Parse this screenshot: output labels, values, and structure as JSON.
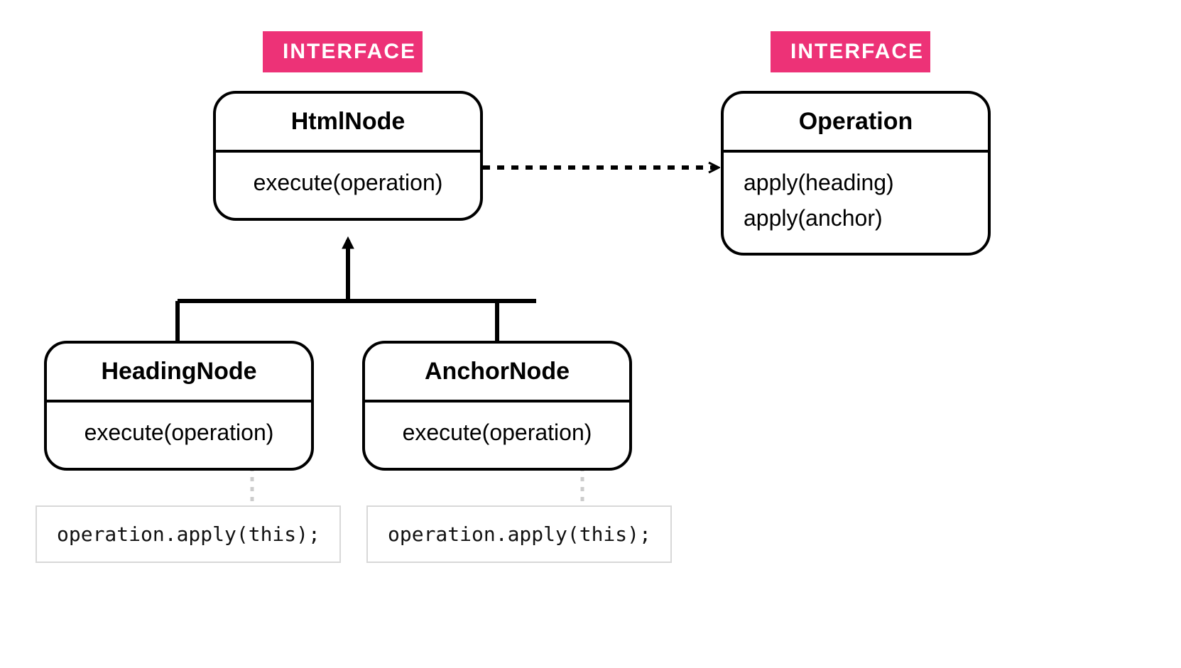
{
  "badges": {
    "left": "INTERFACE",
    "right": "INTERFACE"
  },
  "htmlNode": {
    "name": "HtmlNode",
    "method": "execute(operation)"
  },
  "operation": {
    "name": "Operation",
    "method1": "apply(heading)",
    "method2": "apply(anchor)"
  },
  "headingNode": {
    "name": "HeadingNode",
    "method": "execute(operation)",
    "note": "operation.apply(this);"
  },
  "anchorNode": {
    "name": "AnchorNode",
    "method": "execute(operation)",
    "note": "operation.apply(this);"
  },
  "colors": {
    "badge": "#ed3277",
    "border": "#000000",
    "noteBorder": "#d8d8d8"
  }
}
